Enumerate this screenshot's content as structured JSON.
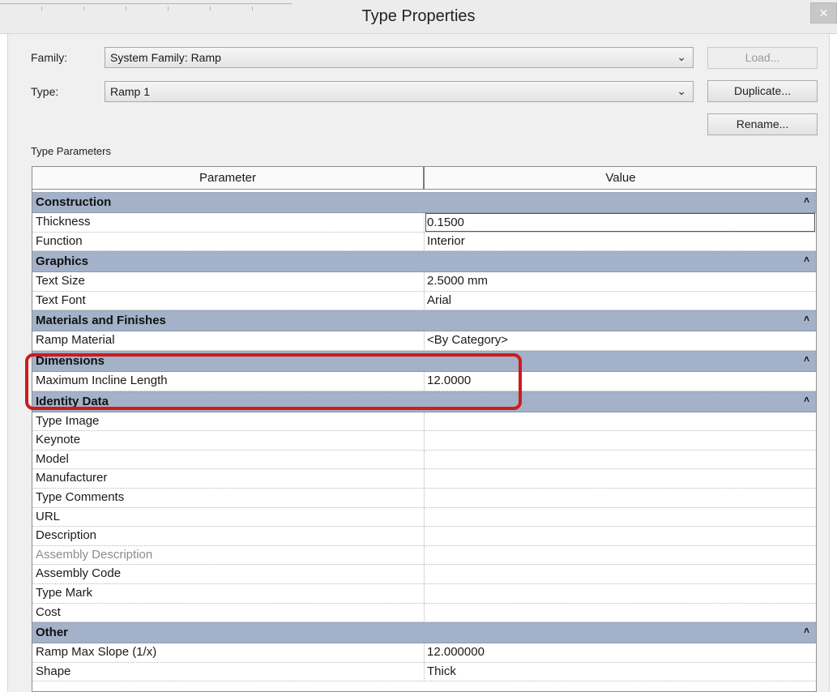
{
  "window": {
    "title": "Type Properties",
    "close": "×"
  },
  "family": {
    "label": "Family:",
    "value": "System Family: Ramp"
  },
  "type": {
    "label": "Type:",
    "value": "Ramp 1"
  },
  "buttons": {
    "load": "Load...",
    "duplicate": "Duplicate...",
    "rename": "Rename..."
  },
  "section_label": "Type Parameters",
  "table": {
    "headers": [
      "Parameter",
      "Value"
    ],
    "groups": [
      {
        "name": "Construction",
        "rows": [
          {
            "parameter": "Thickness",
            "value": "0.1500",
            "editing": true
          },
          {
            "parameter": "Function",
            "value": "Interior"
          }
        ]
      },
      {
        "name": "Graphics",
        "rows": [
          {
            "parameter": "Text Size",
            "value": "2.5000 mm"
          },
          {
            "parameter": "Text Font",
            "value": "Arial"
          }
        ]
      },
      {
        "name": "Materials and Finishes",
        "rows": [
          {
            "parameter": "Ramp Material",
            "value": "<By Category>"
          }
        ]
      },
      {
        "name": "Dimensions",
        "highlighted": true,
        "rows": [
          {
            "parameter": "Maximum Incline Length",
            "value": "12.0000"
          }
        ]
      },
      {
        "name": "Identity Data",
        "rows": [
          {
            "parameter": "Type Image",
            "value": ""
          },
          {
            "parameter": "Keynote",
            "value": ""
          },
          {
            "parameter": "Model",
            "value": ""
          },
          {
            "parameter": "Manufacturer",
            "value": ""
          },
          {
            "parameter": "Type Comments",
            "value": ""
          },
          {
            "parameter": "URL",
            "value": ""
          },
          {
            "parameter": "Description",
            "value": ""
          },
          {
            "parameter": "Assembly Description",
            "value": "",
            "disabled": true
          },
          {
            "parameter": "Assembly Code",
            "value": ""
          },
          {
            "parameter": "Type Mark",
            "value": ""
          },
          {
            "parameter": "Cost",
            "value": ""
          }
        ]
      },
      {
        "name": "Other",
        "rows": [
          {
            "parameter": "Ramp Max Slope (1/x)",
            "value": "12.000000"
          },
          {
            "parameter": "Shape",
            "value": "Thick"
          }
        ]
      }
    ]
  },
  "colors": {
    "group_header": "#a3b2c9",
    "highlight": "#cc1c1c"
  }
}
